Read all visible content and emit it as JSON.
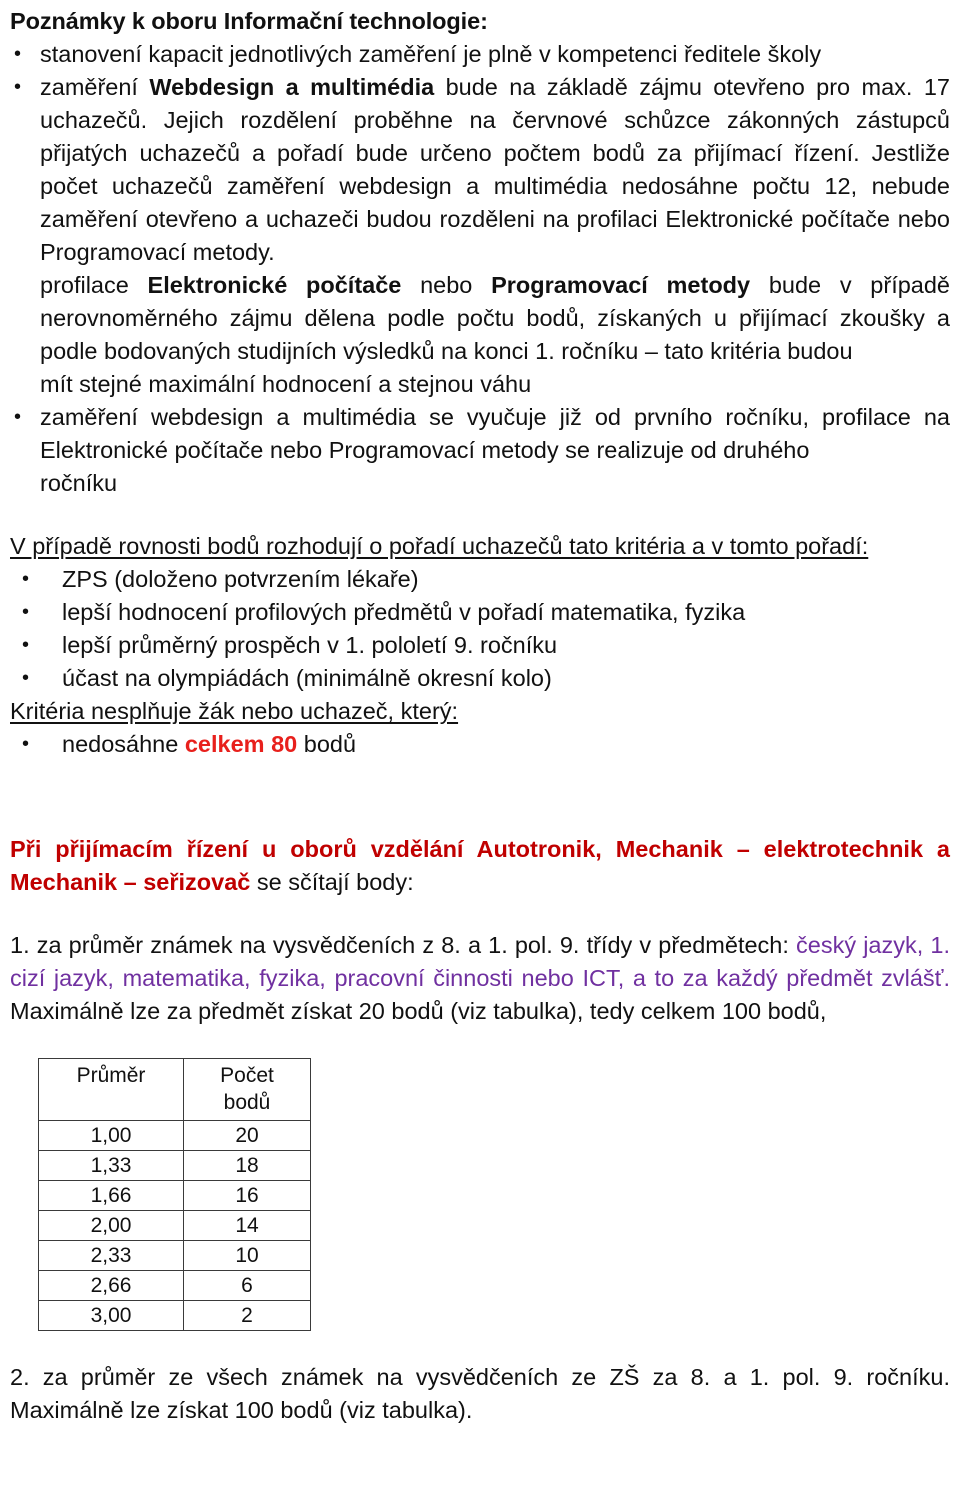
{
  "document": {
    "notes_heading": "Poznámky k oboru Informační technologie:",
    "notes_bullets": [
      {
        "pre": "stanovení kapacit jednotlivých zaměření je plně v kompetenci ředitele školy",
        "bold": "",
        "post": ""
      },
      {
        "pre": "zaměření ",
        "bold": "Webdesign a multimédia",
        "post": " bude na základě zájmu otevřeno pro max. 17 uchazečů. Jejich rozdělení proběhne na červnové schůzce zákonných zástupců přijatých uchazečů a pořadí bude určeno počtem bodů za přijímací řízení. Jestliže počet uchazečů zaměření webdesign a multimédia nedosáhne počtu 12, nebude zaměření otevřeno a uchazeči budou rozděleni na profilaci Elektronické počítače nebo Programovací metody."
      }
    ],
    "profilace_paragraph": {
      "p1": "profilace ",
      "b1": "Elektronické počítače",
      "p2": " nebo ",
      "b2": "Programovací metody",
      "p3": " bude v případě nerovnoměrného zájmu dělena podle počtu bodů, získaných u přijímací zkoušky a podle bodovaných studijních výsledků na konci 1. ročníku – tato kritéria budou",
      "p4": "mít stejné maximální hodnocení a stejnou váhu"
    },
    "vyucuje_bullet": {
      "main": "zaměření webdesign a multimédia se vyučuje již od prvního ročníku, profilace na Elektronické počítače nebo Programovací metody se realizuje od druhého",
      "tail": "ročníku"
    },
    "rovnost_heading": "V případě rovnosti bodů rozhodují o pořadí uchazečů tato kritéria a v tomto pořadí:",
    "rovnost_items": [
      "ZPS (doloženo potvrzením lékaře)",
      "lepší hodnocení profilových předmětů v pořadí matematika, fyzika",
      "lepší průměrný prospěch v 1. pololetí 9. ročníku",
      "účast na olympiádách (minimálně okresní kolo)"
    ],
    "nesplnuje_heading": "Kritéria nesplňuje žák nebo uchazeč, který:",
    "nesplnuje_item": {
      "pre": "nedosáhne ",
      "red": "celkem 80",
      "post": " bodů"
    },
    "red_heading": {
      "red_part": "Při přijímacím řízení u oborů vzdělání Autotronik, Mechanik – elektrotechnik a Mechanik – seřizovač",
      "plain_part": " se sčítají body:"
    },
    "item1": {
      "p1": "1. za průměr známek na vysvědčeních z 8. a 1. pol. 9. třídy v předmětech: ",
      "purple": "český jazyk, 1. cizí jazyk, matematika, fyzika, pracovní činnosti nebo ICT, a to za každý předmět zvlášť.",
      "p2": " Maximálně lze za předmět získat 20 bodů (viz tabulka), tedy celkem 100 bodů,"
    },
    "item2": "2. za průměr ze všech známek na vysvědčeních ze ZŠ za 8. a 1. pol. 9. ročníku. Maximálně lze získat 100 bodů (viz tabulka).",
    "bullet_glyph": "•"
  },
  "table": {
    "headers": [
      "Průměr",
      "Počet",
      "bodů"
    ],
    "rows": [
      {
        "prumer": "1,00",
        "body": "20"
      },
      {
        "prumer": "1,33",
        "body": "18"
      },
      {
        "prumer": "1,66",
        "body": "16"
      },
      {
        "prumer": "2,00",
        "body": "14"
      },
      {
        "prumer": "2,33",
        "body": "10"
      },
      {
        "prumer": "2,66",
        "body": "6"
      },
      {
        "prumer": "3,00",
        "body": "2"
      }
    ]
  },
  "colors": {
    "red_heading": "#C00000",
    "red_emphasis": "#E8201C",
    "purple": "#7030A0",
    "text": "#111111"
  }
}
